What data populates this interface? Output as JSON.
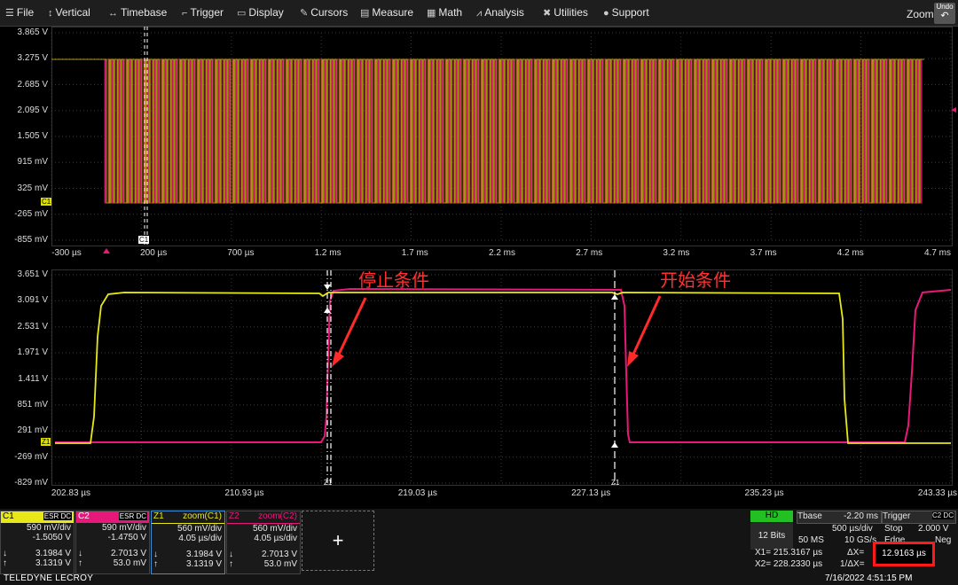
{
  "menu": {
    "items": [
      {
        "label": "File",
        "icon": "hamburger-icon",
        "glyph": "☰"
      },
      {
        "label": "Vertical",
        "icon": "vertical-arrows-icon",
        "glyph": "↕"
      },
      {
        "label": "Timebase",
        "icon": "horizontal-arrows-icon",
        "glyph": "↔"
      },
      {
        "label": "Trigger",
        "icon": "trigger-icon",
        "glyph": "⌐"
      },
      {
        "label": "Display",
        "icon": "display-icon",
        "glyph": "▭"
      },
      {
        "label": "Cursors",
        "icon": "cursor-icon",
        "glyph": "✎"
      },
      {
        "label": "Measure",
        "icon": "measure-icon",
        "glyph": "▤"
      },
      {
        "label": "Math",
        "icon": "math-icon",
        "glyph": "▦"
      },
      {
        "label": "Analysis",
        "icon": "analysis-icon",
        "glyph": "⩘"
      },
      {
        "label": "Utilities",
        "icon": "utilities-icon",
        "glyph": "✖"
      },
      {
        "label": "Support",
        "icon": "support-icon",
        "glyph": "●"
      }
    ],
    "zoom_label": "Zoom",
    "undo_label": "Undo"
  },
  "top_grid": {
    "y_labels": [
      "3.865 V",
      "3.275 V",
      "2.685 V",
      "2.095 V",
      "1.505 V",
      "915 mV",
      "325 mV",
      "-265 mV",
      "-855 mV"
    ],
    "x_labels": [
      "-300 µs",
      "200 µs",
      "700 µs",
      "1.2 ms",
      "1.7 ms",
      "2.2 ms",
      "2.7 ms",
      "3.2 ms",
      "3.7 ms",
      "4.2 ms",
      "4.7 ms"
    ],
    "c1_tag": "C1",
    "cursor_tag": "C1"
  },
  "bottom_grid": {
    "y_labels": [
      "3.651 V",
      "3.091 V",
      "2.531 V",
      "1.971 V",
      "1.411 V",
      "851 mV",
      "291 mV",
      "-269 mV",
      "-829 mV"
    ],
    "x_labels": [
      "202.83 µs",
      "210.93 µs",
      "219.03 µs",
      "227.13 µs",
      "235.23 µs",
      "243.33 µs"
    ],
    "z1_tag": "Z1",
    "cursor1_tag": "Z1",
    "cursor2_tag": "Z1",
    "annotation_stop": "停止条件",
    "annotation_start": "开始条件",
    "colors": {
      "ch1": "#e8e818",
      "ch2": "#e8187a",
      "annot": "#ff2a2a"
    }
  },
  "channels": [
    {
      "name": "C1",
      "badges": "ESR DC",
      "vdiv": "590 mV/div",
      "offset": "-1.5050 V",
      "v1": "3.1984 V",
      "v2": "3.1319 V",
      "color": "#e8e818"
    },
    {
      "name": "C2",
      "badges": "ESR DC",
      "vdiv": "590 mV/div",
      "offset": "-1.4750 V",
      "v1": "2.7013 V",
      "v2": "53.0 mV",
      "color": "#e8187a"
    },
    {
      "name": "Z1",
      "sub": "zoom(C1)",
      "vdiv": "560 mV/div",
      "offset": "4.05 µs/div",
      "v1": "3.1984 V",
      "v2": "3.1319 V",
      "color": "#e8e818"
    },
    {
      "name": "Z2",
      "sub": "zoom(C2)",
      "vdiv": "560 mV/div",
      "offset": "4.05 µs/div",
      "v1": "2.7013 V",
      "v2": "53.0 mV",
      "color": "#e8187a"
    }
  ],
  "acq": {
    "hd": "HD",
    "bits": "12 Bits",
    "tbase_label": "Tbase",
    "tbase_val": "-2.20 ms",
    "tdiv": "500 µs/div",
    "sample_pts": "50 MS",
    "sample_rate": "10 GS/s",
    "trigger_label": "Trigger",
    "trigger_badge": "C2 DC",
    "trig_mode": "Stop",
    "trig_level": "2.000 V",
    "trig_type": "Edge",
    "trig_slope": "Neg",
    "x1": "X1= 215.3167 µs",
    "x2": "X2= 228.2330 µs",
    "dx_label": "ΔX=",
    "dx_val": "12.9163 µs",
    "inv_dx": "1/ΔX="
  },
  "footer": {
    "logo": "TELEDYNE LECROY",
    "datetime": "7/16/2022 4:51:15 PM"
  }
}
